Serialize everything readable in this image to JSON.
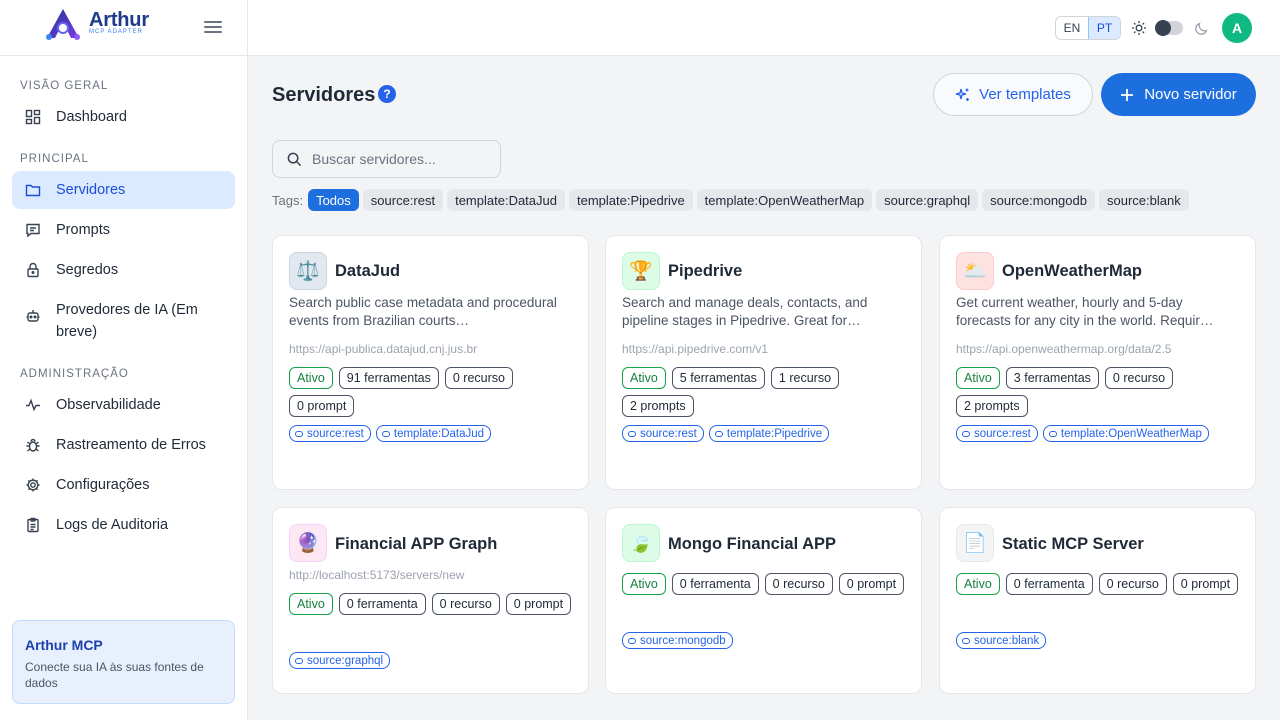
{
  "brand": {
    "name": "Arthur",
    "subtitle": "MCP ADAPTER"
  },
  "sidebar": {
    "sections": [
      {
        "label": "VISÃO GERAL"
      },
      {
        "label": "PRINCIPAL"
      },
      {
        "label": "ADMINISTRAÇÃO"
      }
    ],
    "items": [
      {
        "label": "Dashboard",
        "icon": "dashboard-icon"
      },
      {
        "label": "Servidores",
        "icon": "folder-icon",
        "active": true
      },
      {
        "label": "Prompts",
        "icon": "message-icon"
      },
      {
        "label": "Segredos",
        "icon": "lock-icon"
      },
      {
        "label": "Provedores de IA (Em breve)",
        "icon": "bot-icon"
      },
      {
        "label": "Observabilidade",
        "icon": "activity-icon"
      },
      {
        "label": "Rastreamento de Erros",
        "icon": "bug-icon"
      },
      {
        "label": "Configurações",
        "icon": "gear-icon"
      },
      {
        "label": "Logs de Auditoria",
        "icon": "clipboard-icon"
      }
    ],
    "promo": {
      "title": "Arthur MCP",
      "text": "Conecte sua IA às suas fontes de dados"
    }
  },
  "topbar": {
    "languages": [
      "EN",
      "PT"
    ],
    "active_language": "PT",
    "avatar_initial": "A"
  },
  "page": {
    "title": "Servidores",
    "help": "?",
    "templates_button": "Ver templates",
    "new_button": "Novo servidor",
    "search_placeholder": "Buscar servidores...",
    "tags_label": "Tags:",
    "tags": [
      "Todos",
      "source:rest",
      "template:DataJud",
      "template:Pipedrive",
      "template:OpenWeatherMap",
      "source:graphql",
      "source:mongodb",
      "source:blank"
    ],
    "active_tag": "Todos"
  },
  "servers": [
    {
      "name": "DataJud",
      "icon": "⚖️",
      "description": "Search public case metadata and procedural events from Brazilian courts…",
      "url": "https://api-publica.datajud.cnj.jus.br",
      "status": "Ativo",
      "stats": [
        "91 ferramentas",
        "0 recurso",
        "0 prompt"
      ],
      "tags": [
        "source:rest",
        "template:DataJud"
      ]
    },
    {
      "name": "Pipedrive",
      "icon": "🏆",
      "description": "Search and manage deals, contacts, and pipeline stages in Pipedrive. Great for…",
      "url": "https://api.pipedrive.com/v1",
      "status": "Ativo",
      "stats": [
        "5 ferramentas",
        "1 recurso",
        "2 prompts"
      ],
      "tags": [
        "source:rest",
        "template:Pipedrive"
      ]
    },
    {
      "name": "OpenWeatherMap",
      "icon": "🌥️",
      "description": "Get current weather, hourly and 5-day forecasts for any city in the world. Requir…",
      "url": "https://api.openweathermap.org/data/2.5",
      "status": "Ativo",
      "stats": [
        "3 ferramentas",
        "0 recurso",
        "2 prompts"
      ],
      "tags": [
        "source:rest",
        "template:OpenWeatherMap"
      ]
    },
    {
      "name": "Financial APP Graph",
      "icon": "🔮",
      "description": "",
      "url": "http://localhost:5173/servers/new",
      "status": "Ativo",
      "stats": [
        "0 ferramenta",
        "0 recurso",
        "0 prompt"
      ],
      "tags": [
        "source:graphql"
      ]
    },
    {
      "name": "Mongo Financial APP",
      "icon": "🍃",
      "description": "",
      "url": "",
      "status": "Ativo",
      "stats": [
        "0 ferramenta",
        "0 recurso",
        "0 prompt"
      ],
      "tags": [
        "source:mongodb"
      ]
    },
    {
      "name": "Static MCP Server",
      "icon": "📄",
      "description": "",
      "url": "",
      "status": "Ativo",
      "stats": [
        "0 ferramenta",
        "0 recurso",
        "0 prompt"
      ],
      "tags": [
        "source:blank"
      ]
    }
  ]
}
